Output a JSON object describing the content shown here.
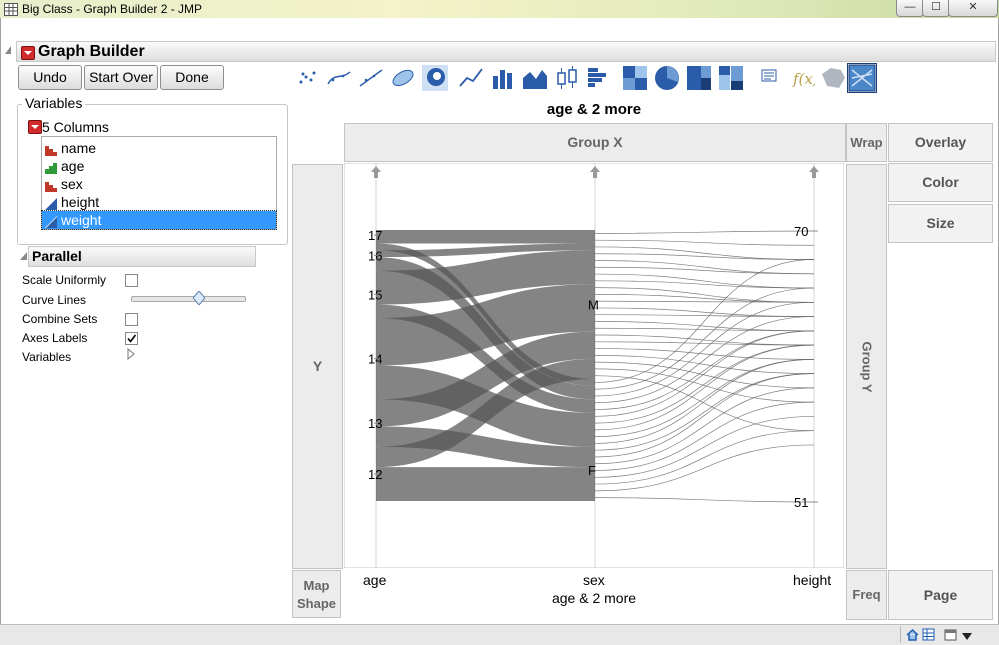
{
  "window": {
    "title": "Big Class - Graph Builder 2 - JMP",
    "minimize": "—",
    "maximize": "☐",
    "close": "✕"
  },
  "graph_builder": {
    "title": "Graph Builder",
    "buttons": {
      "undo": "Undo",
      "start_over": "Start Over",
      "done": "Done"
    }
  },
  "variables": {
    "legend": "Variables",
    "columns_header": "5 Columns",
    "columns": [
      {
        "name": "name",
        "type": "nominal-icon"
      },
      {
        "name": "age",
        "type": "ordinal-icon"
      },
      {
        "name": "sex",
        "type": "nominal-icon"
      },
      {
        "name": "height",
        "type": "continuous-icon"
      },
      {
        "name": "weight",
        "type": "continuous-icon",
        "selected": true
      }
    ]
  },
  "parallel": {
    "title": "Parallel",
    "options": {
      "scale_uniformly": "Scale Uniformly",
      "curve_lines": "Curve Lines",
      "combine_sets": "Combine Sets",
      "axes_labels": "Axes Labels",
      "variables": "Variables"
    },
    "scale_uniformly_checked": false,
    "combine_sets_checked": false,
    "axes_labels_checked": true,
    "curve_lines_level": 0.6
  },
  "drop_zones": {
    "group_x": "Group X",
    "wrap": "Wrap",
    "overlay": "Overlay",
    "color": "Color",
    "size": "Size",
    "y": "Y",
    "group_y": "Group Y",
    "map_shape": "Map\nShape",
    "freq": "Freq",
    "page": "Page"
  },
  "toolbar_icons": [
    "points-icon",
    "smoother-icon",
    "line-of-fit-icon",
    "ellipse-icon",
    "contour-icon",
    "line-icon",
    "bar-icon",
    "area-icon",
    "box-plot-icon",
    "histogram-icon",
    "heatmap-icon",
    "pie-icon",
    "treemap-icon",
    "mosaic-icon",
    "caption-box-icon",
    "formula-icon",
    "map-shapes-icon",
    "parallel-plot-icon"
  ],
  "plot": {
    "title": "age & 2 more",
    "x_caption": "age & 2 more",
    "axes": [
      "age",
      "sex",
      "height"
    ],
    "age_ticks": [
      "17",
      "16",
      "15",
      "14",
      "13",
      "12"
    ],
    "sex_ticks": [
      "M",
      "F"
    ],
    "height_ticks": [
      "70",
      "51"
    ]
  },
  "chart_data": {
    "type": "parallel",
    "title": "age & 2 more",
    "xlabel": "age & 2 more",
    "axes": [
      "age",
      "sex",
      "height"
    ],
    "age": {
      "values": [
        12,
        13,
        14,
        15,
        16,
        17
      ],
      "counts": {
        "12": 8,
        "13": 7,
        "14": 12,
        "15": 7,
        "16": 3,
        "17": 3
      }
    },
    "sex": {
      "values": [
        "F",
        "M"
      ],
      "counts": {
        "F": 18,
        "M": 22
      }
    },
    "height": {
      "range": [
        51,
        70
      ]
    },
    "flows_age_sex": [
      {
        "age": 17,
        "sex": "M",
        "count": 2
      },
      {
        "age": 17,
        "sex": "F",
        "count": 1
      },
      {
        "age": 16,
        "sex": "M",
        "count": 1
      },
      {
        "age": 16,
        "sex": "F",
        "count": 2
      },
      {
        "age": 15,
        "sex": "M",
        "count": 5
      },
      {
        "age": 15,
        "sex": "F",
        "count": 2
      },
      {
        "age": 14,
        "sex": "M",
        "count": 7
      },
      {
        "age": 14,
        "sex": "F",
        "count": 5
      },
      {
        "age": 13,
        "sex": "M",
        "count": 4
      },
      {
        "age": 13,
        "sex": "F",
        "count": 3
      },
      {
        "age": 12,
        "sex": "M",
        "count": 3
      },
      {
        "age": 12,
        "sex": "F",
        "count": 5
      }
    ],
    "heights_M": [
      70,
      69,
      68,
      68,
      67,
      67,
      66,
      66,
      65,
      65,
      65,
      64,
      64,
      63,
      63,
      62,
      62,
      61,
      60,
      59,
      58,
      56
    ],
    "heights_F": [
      68,
      66,
      65,
      64,
      63,
      63,
      62,
      62,
      61,
      61,
      60,
      60,
      59,
      58,
      57,
      56,
      55,
      51
    ]
  },
  "status_icons": [
    "home-icon",
    "table-icon",
    "window-icon",
    "dropdown-icon"
  ]
}
